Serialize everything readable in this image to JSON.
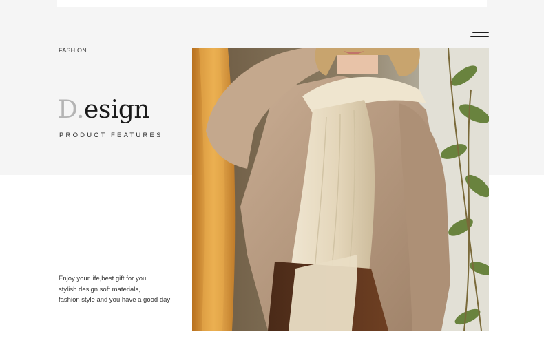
{
  "header": {
    "menu_icon": "hamburger-menu-icon"
  },
  "intro": {
    "category": "FASHION",
    "title_initial": "D.",
    "title_rest": "esign",
    "subtitle": "PRODUCT FEATURES"
  },
  "description": {
    "lines": [
      "Enjoy your life,best gift for you",
      "stylish design soft materials,",
      "fashion style and you have a good day"
    ]
  },
  "photo": {
    "subject": "model-wearing-cream-scarf-and-beige-sweater"
  },
  "colors": {
    "band_background": "#f5f5f5",
    "title_initial": "#b4b4b4",
    "title_text": "#1a1a1a",
    "sweater": "#b89a80",
    "scarf": "#e8dcc3",
    "mirror_frame": "#d89a3e"
  }
}
